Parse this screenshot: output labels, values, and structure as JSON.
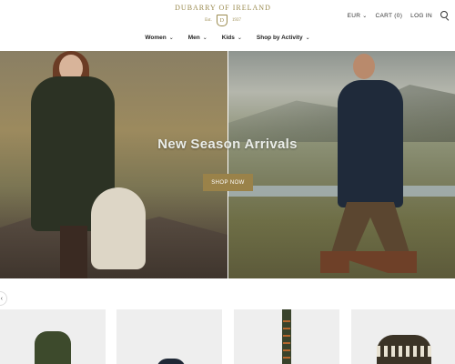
{
  "brand": {
    "name": "DUBARRY OF IRELAND",
    "est_label": "Est.",
    "est_year": "1937",
    "crest_letter": "D"
  },
  "header": {
    "currency": "EUR",
    "cart": "CART (0)",
    "login": "LOG IN"
  },
  "nav": {
    "items": [
      {
        "label": "Women"
      },
      {
        "label": "Men"
      },
      {
        "label": "Kids"
      },
      {
        "label": "Shop by Activity"
      }
    ]
  },
  "hero": {
    "title": "New Season Arrivals",
    "cta": "SHOP NOW"
  },
  "icons": {
    "search": "search-icon",
    "chevron": "chevron-down-icon",
    "prev": "chevron-left-icon"
  },
  "glyphs": {
    "chevron": "⌄",
    "prev": "‹"
  },
  "colors": {
    "accent": "#9a8249",
    "logo": "#9a8a4e",
    "tile_bg": "#eeeeee"
  },
  "products": [
    {
      "kind": "jacket"
    },
    {
      "kind": "cap"
    },
    {
      "kind": "tie"
    },
    {
      "kind": "sweater"
    }
  ]
}
